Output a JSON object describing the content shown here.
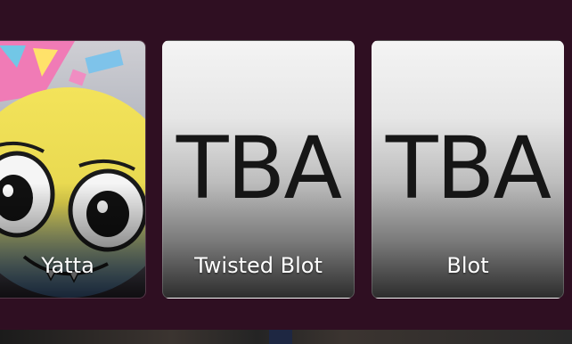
{
  "cards": [
    {
      "label": "Yatta"
    },
    {
      "label": "Twisted Blot",
      "placeholder_text": "TBA"
    },
    {
      "label": "Blot",
      "placeholder_text": "TBA"
    }
  ]
}
